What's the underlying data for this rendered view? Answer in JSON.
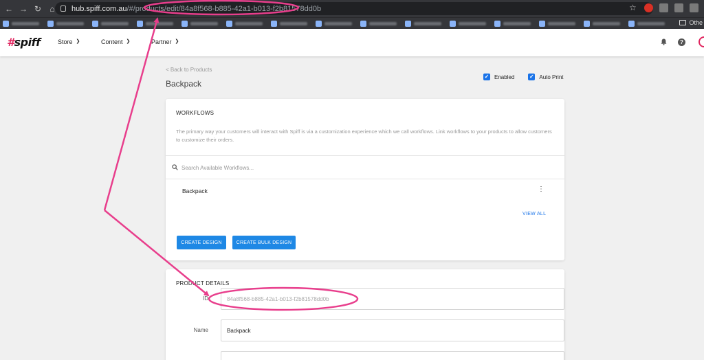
{
  "browser": {
    "url_host": "hub.spiff.com.au",
    "url_path": "/#/products/edit/84a8f568-b885-42a1-b013-f2b81578dd0b",
    "bookmarks_other": "Othe"
  },
  "header": {
    "logo_hash": "#",
    "logo_text": "spiff",
    "nav": [
      {
        "label": "Store"
      },
      {
        "label": "Content"
      },
      {
        "label": "Partner"
      }
    ]
  },
  "page": {
    "back_link": "< Back to Products",
    "title": "Backpack",
    "enabled_label": "Enabled",
    "auto_print_label": "Auto Print",
    "enabled_checked": true,
    "auto_print_checked": true
  },
  "workflows": {
    "heading": "WORKFLOWS",
    "description": "The primary way your customers will interact with Spiff is via a customization experience which we call workflows. Link workflows to your products to allow customers to customize their orders.",
    "search_placeholder": "Search Available Workflows...",
    "items": [
      {
        "name": "Backpack"
      }
    ],
    "view_all": "VIEW ALL",
    "create_design": "CREATE DESIGN",
    "create_bulk_design": "CREATE BULK DESIGN"
  },
  "product_details": {
    "heading": "PRODUCT DETAILS",
    "id_label": "ID",
    "id_value": "84a8f568-b885-42a1-b013-f2b81578dd0b",
    "name_label": "Name",
    "name_value": "Backpack"
  },
  "colors": {
    "brand_pink": "#e0245e",
    "primary_blue": "#1e88e5",
    "annotation": "#e83e8c"
  },
  "icons": [
    "back-arrow-icon",
    "forward-arrow-icon",
    "reload-icon",
    "home-icon",
    "lock-icon",
    "star-icon",
    "chevron-down-icon",
    "bell-icon",
    "help-icon",
    "search-icon",
    "kebab-menu-icon",
    "checkbox-icon"
  ]
}
